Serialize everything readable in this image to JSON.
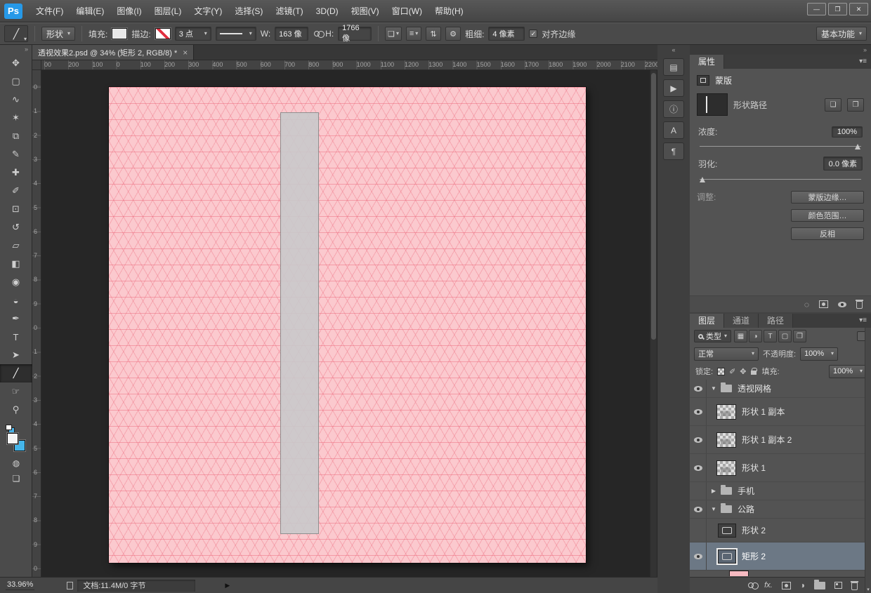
{
  "titlebar": {
    "logo": "Ps",
    "menus": [
      "文件(F)",
      "编辑(E)",
      "图像(I)",
      "图层(L)",
      "文字(Y)",
      "选择(S)",
      "滤镜(T)",
      "3D(D)",
      "视图(V)",
      "窗口(W)",
      "帮助(H)"
    ]
  },
  "window_controls": {
    "minimize": "—",
    "restore": "❐",
    "close": "✕"
  },
  "icons": {
    "collapse_left": "«",
    "collapse_right": "»",
    "gear": "⚙",
    "tool_chip": "╱",
    "path_ops": "❏",
    "path_align": "≡",
    "path_arrange": "⇅",
    "check": "✓",
    "load_selection": "◌",
    "adjustment_half": "◑",
    "pixel_mask_btn": "❏",
    "vector_mask_btn": "❐",
    "status_arrow": "▶"
  },
  "options_bar": {
    "mode": "形状",
    "fill_label": "填充:",
    "stroke_label": "描边:",
    "stroke_size": "3 点",
    "w_label": "W:",
    "w_value": "163 像",
    "h_label": "H:",
    "h_value": "1766 像",
    "weight_label": "粗细:",
    "weight_value": "4 像素",
    "align_edges": "对齐边缘",
    "workspace": "基本功能"
  },
  "toolbar": {
    "tools": [
      {
        "name": "move-tool",
        "glyph": "✥"
      },
      {
        "name": "marquee-tool",
        "glyph": "▢"
      },
      {
        "name": "lasso-tool",
        "glyph": "∿"
      },
      {
        "name": "quick-selection-tool",
        "glyph": "✶"
      },
      {
        "name": "crop-tool",
        "glyph": "⧉"
      },
      {
        "name": "eyedropper-tool",
        "glyph": "✎"
      },
      {
        "name": "healing-brush-tool",
        "glyph": "✚"
      },
      {
        "name": "brush-tool",
        "glyph": "✐"
      },
      {
        "name": "clone-stamp-tool",
        "glyph": "⊡"
      },
      {
        "name": "history-brush-tool",
        "glyph": "↺"
      },
      {
        "name": "eraser-tool",
        "glyph": "▱"
      },
      {
        "name": "gradient-tool",
        "glyph": "◧"
      },
      {
        "name": "blur-tool",
        "glyph": "◉"
      },
      {
        "name": "dodge-tool",
        "glyph": "◒"
      },
      {
        "name": "pen-tool",
        "glyph": "✒"
      },
      {
        "name": "type-tool",
        "glyph": "T"
      },
      {
        "name": "path-selection-tool",
        "glyph": "➤"
      },
      {
        "name": "line-tool",
        "glyph": "╱",
        "selected": true
      },
      {
        "name": "hand-tool",
        "glyph": "☞"
      },
      {
        "name": "zoom-tool",
        "glyph": "⚲"
      }
    ]
  },
  "document": {
    "tab_title": "透视效果2.psd @ 34% (矩形 2, RGB/8) *",
    "tab_close": "×",
    "ruler_h": [
      "00",
      "200",
      "100",
      "0",
      "100",
      "200",
      "300",
      "400",
      "500",
      "600",
      "700",
      "800",
      "900",
      "1000",
      "1100",
      "1200",
      "1300",
      "1400",
      "1500",
      "1600",
      "1700",
      "1800",
      "1900",
      "2000",
      "2100",
      "2200"
    ],
    "ruler_v": [
      "0",
      "1",
      "2",
      "3",
      "4",
      "5",
      "6",
      "7",
      "8",
      "9",
      "0",
      "1",
      "2",
      "3",
      "4",
      "5",
      "6",
      "7",
      "8",
      "9",
      "0"
    ],
    "canvas": {
      "bg": "#fbc9ce",
      "grid": "#e9546a",
      "shape_fill": "#c9c9cb",
      "shape_border": "#8f8f8f"
    }
  },
  "panel_strip": [
    {
      "name": "history-panel-icon",
      "glyph": "▤"
    },
    {
      "name": "actions-panel-icon",
      "glyph": "▶"
    },
    {
      "name": "info-panel-icon",
      "glyph": "ⓘ"
    },
    {
      "name": "character-panel-icon",
      "glyph": "A"
    },
    {
      "name": "paragraph-panel-icon",
      "glyph": "¶"
    }
  ],
  "properties_panel": {
    "tab": "属性",
    "mask_label": "蒙版",
    "path_label": "形状路径",
    "density_label": "浓度:",
    "density_value": "100%",
    "feather_label": "羽化:",
    "feather_value": "0.0 像素",
    "adjust_label": "调整:",
    "adjust_buttons": [
      "蒙版边缘…",
      "颜色范围…",
      "反相"
    ]
  },
  "layers_panel": {
    "tabs": [
      "图层",
      "通道",
      "路径"
    ],
    "filter_label": "类型",
    "filter_icons": [
      {
        "name": "filter-pixel-icon",
        "glyph": "▦"
      },
      {
        "name": "filter-adjustment-icon",
        "glyph": "◑"
      },
      {
        "name": "filter-text-icon",
        "glyph": "T"
      },
      {
        "name": "filter-shape-icon",
        "glyph": "▢"
      },
      {
        "name": "filter-smart-object-icon",
        "glyph": "❐"
      }
    ],
    "blend_mode": "正常",
    "opacity_label": "不透明度:",
    "opacity_value": "100%",
    "lock_label": "锁定:",
    "lock_paint_glyph": "✐",
    "lock_move_glyph": "✥",
    "fill_label": "填充:",
    "fill_value": "100%",
    "fx_label": "fx.",
    "rows": [
      {
        "kind": "group",
        "name": "透视网格",
        "expanded": true,
        "visible": true
      },
      {
        "kind": "layer",
        "name": "形状 1 副本",
        "visible": true
      },
      {
        "kind": "layer",
        "name": "形状 1 副本 2",
        "visible": true
      },
      {
        "kind": "layer",
        "name": "形状 1",
        "visible": true
      },
      {
        "kind": "group",
        "name": "手机",
        "expanded": false,
        "visible": false
      },
      {
        "kind": "group",
        "name": "公路",
        "expanded": true,
        "visible": true
      },
      {
        "kind": "shape",
        "name": "形状 2",
        "visible": false
      },
      {
        "kind": "shape",
        "name": "矩形 2",
        "visible": true,
        "selected": true
      }
    ]
  },
  "status_bar": {
    "zoom": "33.96%",
    "doc_info": "文档:11.4M/0 字节"
  }
}
